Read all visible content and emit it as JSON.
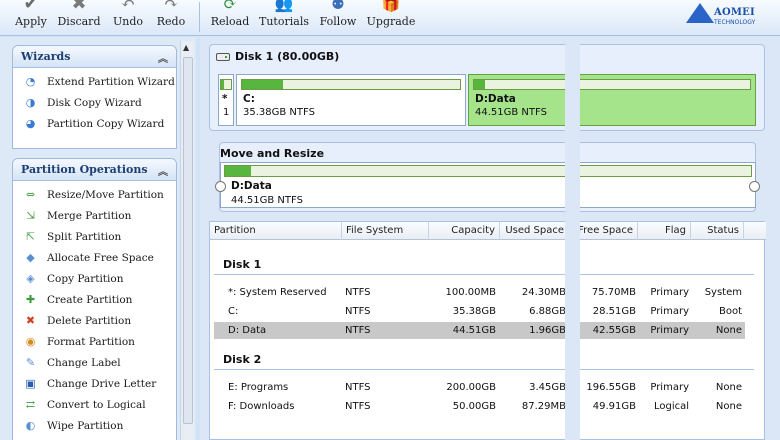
{
  "toolbar": {
    "apply": "Apply",
    "discard": "Discard",
    "undo": "Undo",
    "redo": "Redo",
    "reload": "Reload",
    "tutorials": "Tutorials",
    "follow": "Follow",
    "upgrade": "Upgrade"
  },
  "logo": {
    "name": "AOMEI",
    "sub": "TECHNOLOGY"
  },
  "wizards": {
    "title": "Wizards",
    "items": [
      "Extend Partition Wizard",
      "Disk Copy Wizard",
      "Partition Copy Wizard"
    ]
  },
  "operations": {
    "title": "Partition Operations",
    "items": [
      "Resize/Move Partition",
      "Merge Partition",
      "Split Partition",
      "Allocate Free Space",
      "Copy Partition",
      "Create Partition",
      "Delete Partition",
      "Format Partition",
      "Change Label",
      "Change Drive Letter",
      "Convert to Logical",
      "Wipe Partition"
    ]
  },
  "disk_map": {
    "title": "Disk 1 (80.00GB)",
    "sys": {
      "name": "*",
      "info": "1"
    },
    "c": {
      "name": "C:",
      "info": "35.38GB NTFS",
      "used_fraction": 0.19
    },
    "d": {
      "name": "D:Data",
      "info": "44.51GB NTFS",
      "used_fraction": 0.04
    }
  },
  "move_resize": {
    "title": "Move and Resize",
    "name": "D:Data",
    "info": "44.51GB NTFS",
    "used_fraction": 0.05
  },
  "table": {
    "headers": [
      "Partition",
      "File System",
      "Capacity",
      "Used Space",
      "Free Space",
      "Flag",
      "Status"
    ],
    "groups": [
      {
        "name": "Disk 1",
        "rows": [
          [
            "*: System Reserved",
            "NTFS",
            "100.00MB",
            "24.30MB",
            "75.70MB",
            "Primary",
            "System"
          ],
          [
            "C:",
            "NTFS",
            "35.38GB",
            "6.88GB",
            "28.51GB",
            "Primary",
            "Boot"
          ],
          [
            "D: Data",
            "NTFS",
            "44.51GB",
            "1.96GB",
            "42.55GB",
            "Primary",
            "None"
          ]
        ]
      },
      {
        "name": "Disk 2",
        "rows": [
          [
            "E: Programs",
            "NTFS",
            "200.00GB",
            "3.45GB",
            "196.55GB",
            "Primary",
            "None"
          ],
          [
            "F: Downloads",
            "NTFS",
            "50.00GB",
            "87.29MB",
            "49.91GB",
            "Logical",
            "None"
          ]
        ]
      }
    ]
  },
  "selected_row": "D: Data",
  "colors": {
    "accent": "#56b63e",
    "selected_partition": "#a6e48c",
    "selection_row": "#c8c8c8"
  }
}
